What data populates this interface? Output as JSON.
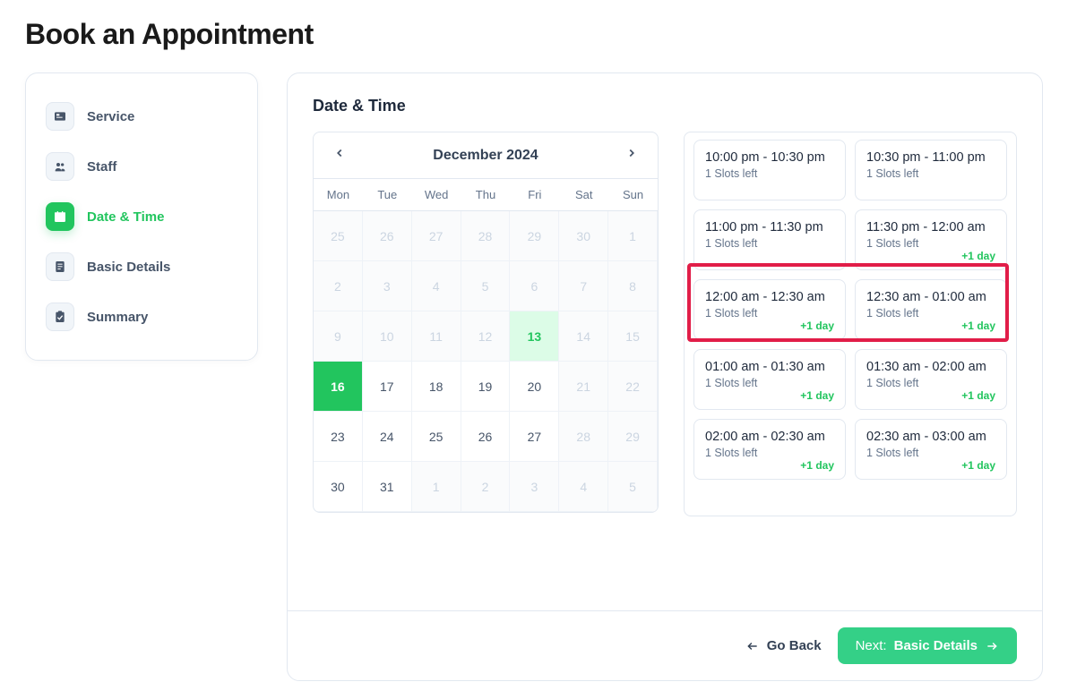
{
  "page_title": "Book an Appointment",
  "sidebar": [
    {
      "key": "service",
      "label": "Service",
      "icon": "card-icon",
      "active": false
    },
    {
      "key": "staff",
      "label": "Staff",
      "icon": "users-icon",
      "active": false
    },
    {
      "key": "datetime",
      "label": "Date & Time",
      "icon": "calendar-icon",
      "active": true
    },
    {
      "key": "details",
      "label": "Basic Details",
      "icon": "document-icon",
      "active": false
    },
    {
      "key": "summary",
      "label": "Summary",
      "icon": "clipboard-check-icon",
      "active": false
    }
  ],
  "section_title": "Date & Time",
  "calendar": {
    "month_label": "December 2024",
    "day_headers": [
      "Mon",
      "Tue",
      "Wed",
      "Thu",
      "Fri",
      "Sat",
      "Sun"
    ],
    "cells": [
      {
        "n": "25",
        "d": true
      },
      {
        "n": "26",
        "d": true
      },
      {
        "n": "27",
        "d": true
      },
      {
        "n": "28",
        "d": true
      },
      {
        "n": "29",
        "d": true
      },
      {
        "n": "30",
        "d": true
      },
      {
        "n": "1",
        "d": true
      },
      {
        "n": "2",
        "d": true
      },
      {
        "n": "3",
        "d": true
      },
      {
        "n": "4",
        "d": true
      },
      {
        "n": "5",
        "d": true
      },
      {
        "n": "6",
        "d": true
      },
      {
        "n": "7",
        "d": true
      },
      {
        "n": "8",
        "d": true
      },
      {
        "n": "9",
        "d": true
      },
      {
        "n": "10",
        "d": true
      },
      {
        "n": "11",
        "d": true
      },
      {
        "n": "12",
        "d": true
      },
      {
        "n": "13",
        "today": true
      },
      {
        "n": "14",
        "d": true
      },
      {
        "n": "15",
        "d": true
      },
      {
        "n": "16",
        "selected": true
      },
      {
        "n": "17"
      },
      {
        "n": "18"
      },
      {
        "n": "19"
      },
      {
        "n": "20"
      },
      {
        "n": "21",
        "d": true
      },
      {
        "n": "22",
        "d": true
      },
      {
        "n": "23"
      },
      {
        "n": "24"
      },
      {
        "n": "25"
      },
      {
        "n": "26"
      },
      {
        "n": "27"
      },
      {
        "n": "28",
        "d": true
      },
      {
        "n": "29",
        "d": true
      },
      {
        "n": "30"
      },
      {
        "n": "31"
      },
      {
        "n": "1",
        "d": true
      },
      {
        "n": "2",
        "d": true
      },
      {
        "n": "3",
        "d": true
      },
      {
        "n": "4",
        "d": true
      },
      {
        "n": "5",
        "d": true
      }
    ]
  },
  "slots_left_label": "1 Slots left",
  "plus_day_label": "+1 day",
  "slots": [
    {
      "time": "10:00 pm - 10:30 pm",
      "extra": false
    },
    {
      "time": "10:30 pm - 11:00 pm",
      "extra": false
    },
    {
      "time": "11:00 pm - 11:30 pm",
      "extra": false
    },
    {
      "time": "11:30 pm - 12:00 am",
      "extra": true
    },
    {
      "time": "12:00 am - 12:30 am",
      "extra": true,
      "highlighted": true
    },
    {
      "time": "12:30 am - 01:00 am",
      "extra": true,
      "highlighted": true
    },
    {
      "time": "01:00 am - 01:30 am",
      "extra": true
    },
    {
      "time": "01:30 am - 02:00 am",
      "extra": true
    },
    {
      "time": "02:00 am - 02:30 am",
      "extra": true
    },
    {
      "time": "02:30 am - 03:00 am",
      "extra": true
    }
  ],
  "footer": {
    "back_label": "Go Back",
    "next_prefix": "Next:",
    "next_strong": "Basic Details"
  }
}
